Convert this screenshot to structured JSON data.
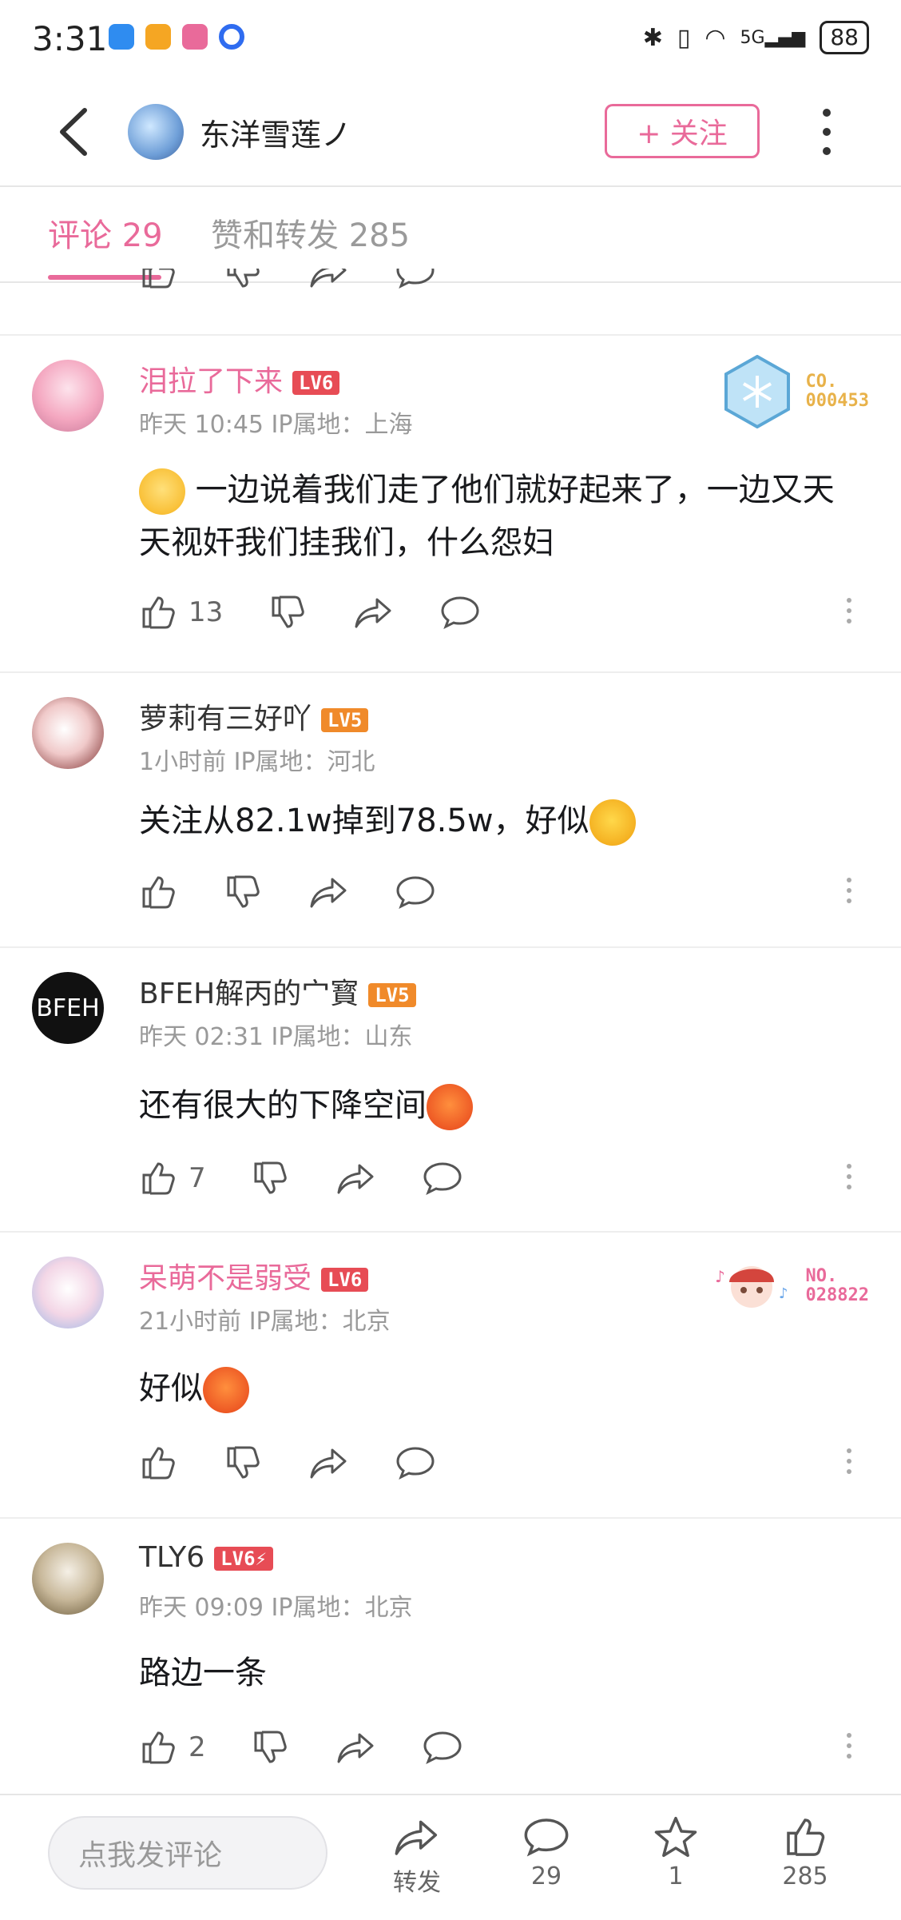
{
  "status": {
    "time": "3:31",
    "battery": "88",
    "network": "5G"
  },
  "header": {
    "title": "东洋雪莲ノ",
    "follow_label": "+ 关注"
  },
  "tabs": {
    "comments": "评论 29",
    "likes_reposts": "赞和转发 285"
  },
  "comments": [
    {
      "name": "泪拉了下来",
      "level": "LV6",
      "time": "昨天 10:45 IP属地：上海",
      "text_before": "",
      "text_after": "一边说着我们走了他们就好起来了，一边又天天视奸我们挂我们，什么怨妇",
      "likes": "13",
      "fan_label": "CO.\n000453",
      "fan_color": "#e8b24a"
    },
    {
      "name": "萝莉有三好吖",
      "level": "LV5",
      "time": "1小时前 IP属地：河北",
      "text_before": "关注从82.1w掉到78.5w，好似",
      "text_after": "",
      "likes": ""
    },
    {
      "name": "BFEH解丙的宀寳",
      "level": "LV5",
      "time": "昨天 02:31 IP属地：山东",
      "text_before": "还有很大的下降空间",
      "text_after": "",
      "likes": "7",
      "avatar_text": "BFEH"
    },
    {
      "name": "呆萌不是弱受",
      "level": "LV6",
      "time": "21小时前 IP属地：北京",
      "text_before": "好似",
      "text_after": "",
      "likes": "",
      "fan_label": "NO.\n028822",
      "fan_color": "#e96a9a"
    },
    {
      "name": "TLY6",
      "level": "LV6⚡",
      "time": "昨天 09:09 IP属地：北京",
      "text_before": "路边一条",
      "text_after": "",
      "likes": "2"
    }
  ],
  "bottom": {
    "input_placeholder": "点我发评论",
    "repost_label": "转发",
    "comments_count": "29",
    "favorites_count": "1",
    "likes_count": "285"
  },
  "colors": {
    "accent": "#e96a9a",
    "lv6": "#e74c55",
    "lv5": "#f08a2a"
  }
}
